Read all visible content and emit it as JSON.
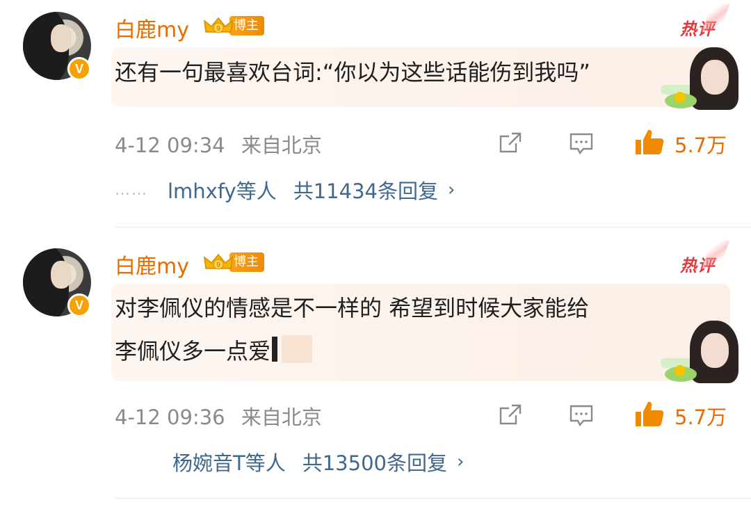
{
  "comments": [
    {
      "username": "白鹿my",
      "badge_label": "博主",
      "hot_label": "热评",
      "text": "还有一句最喜欢台词:“你以为这些话能伤到我吗”",
      "text_line2": "",
      "time": "4-12 09:34",
      "source": "来自北京",
      "likes": "5.7万",
      "reply_dots": "……",
      "reply_users": "lmhxfy等人",
      "reply_count": "共11434条回复",
      "icons": [
        "share-icon",
        "comment-icon",
        "like-icon",
        "chevron-right-icon"
      ]
    },
    {
      "username": "白鹿my",
      "badge_label": "博主",
      "hot_label": "热评",
      "text": "对李佩仪的情感是不一样的 希望到时候大家能给",
      "text_line2": "李佩仪多一点爱",
      "time": "4-12 09:36",
      "source": "来自北京",
      "likes": "5.7万",
      "reply_dots": "",
      "reply_users": "杨婉音T等人",
      "reply_count": "共13500条回复",
      "icons": [
        "share-icon",
        "comment-icon",
        "like-icon",
        "chevron-right-icon"
      ]
    }
  ],
  "colors": {
    "username": "#e86c00",
    "hot": "#e4393c",
    "reply_link": "#40678e",
    "meta": "#8a8a8a",
    "bubble": "#fcefe7",
    "like": "#f08a00"
  }
}
